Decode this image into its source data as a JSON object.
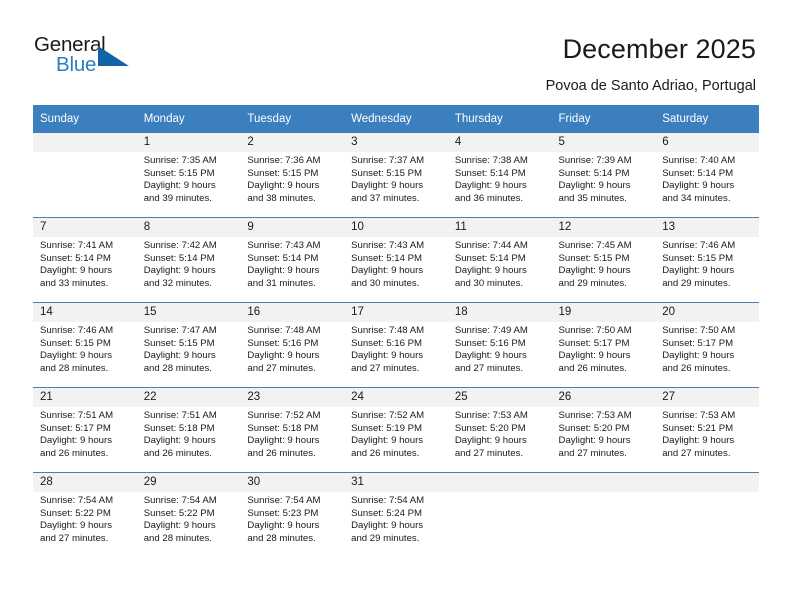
{
  "logo": {
    "word_top": "General",
    "word_bottom": "Blue",
    "accent_color": "#1263a8",
    "blue_text_color": "#2a7fc1"
  },
  "header": {
    "title": "December 2025",
    "subtitle": "Povoa de Santo Adriao, Portugal"
  },
  "calendar": {
    "header_bg": "#3b7fbf",
    "daynum_bg": "#f2f2f2",
    "weekday_headers": [
      "Sunday",
      "Monday",
      "Tuesday",
      "Wednesday",
      "Thursday",
      "Friday",
      "Saturday"
    ],
    "weeks": [
      [
        {
          "day": "",
          "lines": []
        },
        {
          "day": "1",
          "lines": [
            "Sunrise: 7:35 AM",
            "Sunset: 5:15 PM",
            "Daylight: 9 hours",
            "and 39 minutes."
          ]
        },
        {
          "day": "2",
          "lines": [
            "Sunrise: 7:36 AM",
            "Sunset: 5:15 PM",
            "Daylight: 9 hours",
            "and 38 minutes."
          ]
        },
        {
          "day": "3",
          "lines": [
            "Sunrise: 7:37 AM",
            "Sunset: 5:15 PM",
            "Daylight: 9 hours",
            "and 37 minutes."
          ]
        },
        {
          "day": "4",
          "lines": [
            "Sunrise: 7:38 AM",
            "Sunset: 5:14 PM",
            "Daylight: 9 hours",
            "and 36 minutes."
          ]
        },
        {
          "day": "5",
          "lines": [
            "Sunrise: 7:39 AM",
            "Sunset: 5:14 PM",
            "Daylight: 9 hours",
            "and 35 minutes."
          ]
        },
        {
          "day": "6",
          "lines": [
            "Sunrise: 7:40 AM",
            "Sunset: 5:14 PM",
            "Daylight: 9 hours",
            "and 34 minutes."
          ]
        }
      ],
      [
        {
          "day": "7",
          "lines": [
            "Sunrise: 7:41 AM",
            "Sunset: 5:14 PM",
            "Daylight: 9 hours",
            "and 33 minutes."
          ]
        },
        {
          "day": "8",
          "lines": [
            "Sunrise: 7:42 AM",
            "Sunset: 5:14 PM",
            "Daylight: 9 hours",
            "and 32 minutes."
          ]
        },
        {
          "day": "9",
          "lines": [
            "Sunrise: 7:43 AM",
            "Sunset: 5:14 PM",
            "Daylight: 9 hours",
            "and 31 minutes."
          ]
        },
        {
          "day": "10",
          "lines": [
            "Sunrise: 7:43 AM",
            "Sunset: 5:14 PM",
            "Daylight: 9 hours",
            "and 30 minutes."
          ]
        },
        {
          "day": "11",
          "lines": [
            "Sunrise: 7:44 AM",
            "Sunset: 5:14 PM",
            "Daylight: 9 hours",
            "and 30 minutes."
          ]
        },
        {
          "day": "12",
          "lines": [
            "Sunrise: 7:45 AM",
            "Sunset: 5:15 PM",
            "Daylight: 9 hours",
            "and 29 minutes."
          ]
        },
        {
          "day": "13",
          "lines": [
            "Sunrise: 7:46 AM",
            "Sunset: 5:15 PM",
            "Daylight: 9 hours",
            "and 29 minutes."
          ]
        }
      ],
      [
        {
          "day": "14",
          "lines": [
            "Sunrise: 7:46 AM",
            "Sunset: 5:15 PM",
            "Daylight: 9 hours",
            "and 28 minutes."
          ]
        },
        {
          "day": "15",
          "lines": [
            "Sunrise: 7:47 AM",
            "Sunset: 5:15 PM",
            "Daylight: 9 hours",
            "and 28 minutes."
          ]
        },
        {
          "day": "16",
          "lines": [
            "Sunrise: 7:48 AM",
            "Sunset: 5:16 PM",
            "Daylight: 9 hours",
            "and 27 minutes."
          ]
        },
        {
          "day": "17",
          "lines": [
            "Sunrise: 7:48 AM",
            "Sunset: 5:16 PM",
            "Daylight: 9 hours",
            "and 27 minutes."
          ]
        },
        {
          "day": "18",
          "lines": [
            "Sunrise: 7:49 AM",
            "Sunset: 5:16 PM",
            "Daylight: 9 hours",
            "and 27 minutes."
          ]
        },
        {
          "day": "19",
          "lines": [
            "Sunrise: 7:50 AM",
            "Sunset: 5:17 PM",
            "Daylight: 9 hours",
            "and 26 minutes."
          ]
        },
        {
          "day": "20",
          "lines": [
            "Sunrise: 7:50 AM",
            "Sunset: 5:17 PM",
            "Daylight: 9 hours",
            "and 26 minutes."
          ]
        }
      ],
      [
        {
          "day": "21",
          "lines": [
            "Sunrise: 7:51 AM",
            "Sunset: 5:17 PM",
            "Daylight: 9 hours",
            "and 26 minutes."
          ]
        },
        {
          "day": "22",
          "lines": [
            "Sunrise: 7:51 AM",
            "Sunset: 5:18 PM",
            "Daylight: 9 hours",
            "and 26 minutes."
          ]
        },
        {
          "day": "23",
          "lines": [
            "Sunrise: 7:52 AM",
            "Sunset: 5:18 PM",
            "Daylight: 9 hours",
            "and 26 minutes."
          ]
        },
        {
          "day": "24",
          "lines": [
            "Sunrise: 7:52 AM",
            "Sunset: 5:19 PM",
            "Daylight: 9 hours",
            "and 26 minutes."
          ]
        },
        {
          "day": "25",
          "lines": [
            "Sunrise: 7:53 AM",
            "Sunset: 5:20 PM",
            "Daylight: 9 hours",
            "and 27 minutes."
          ]
        },
        {
          "day": "26",
          "lines": [
            "Sunrise: 7:53 AM",
            "Sunset: 5:20 PM",
            "Daylight: 9 hours",
            "and 27 minutes."
          ]
        },
        {
          "day": "27",
          "lines": [
            "Sunrise: 7:53 AM",
            "Sunset: 5:21 PM",
            "Daylight: 9 hours",
            "and 27 minutes."
          ]
        }
      ],
      [
        {
          "day": "28",
          "lines": [
            "Sunrise: 7:54 AM",
            "Sunset: 5:22 PM",
            "Daylight: 9 hours",
            "and 27 minutes."
          ]
        },
        {
          "day": "29",
          "lines": [
            "Sunrise: 7:54 AM",
            "Sunset: 5:22 PM",
            "Daylight: 9 hours",
            "and 28 minutes."
          ]
        },
        {
          "day": "30",
          "lines": [
            "Sunrise: 7:54 AM",
            "Sunset: 5:23 PM",
            "Daylight: 9 hours",
            "and 28 minutes."
          ]
        },
        {
          "day": "31",
          "lines": [
            "Sunrise: 7:54 AM",
            "Sunset: 5:24 PM",
            "Daylight: 9 hours",
            "and 29 minutes."
          ]
        },
        {
          "day": "",
          "lines": []
        },
        {
          "day": "",
          "lines": []
        },
        {
          "day": "",
          "lines": []
        }
      ]
    ]
  }
}
